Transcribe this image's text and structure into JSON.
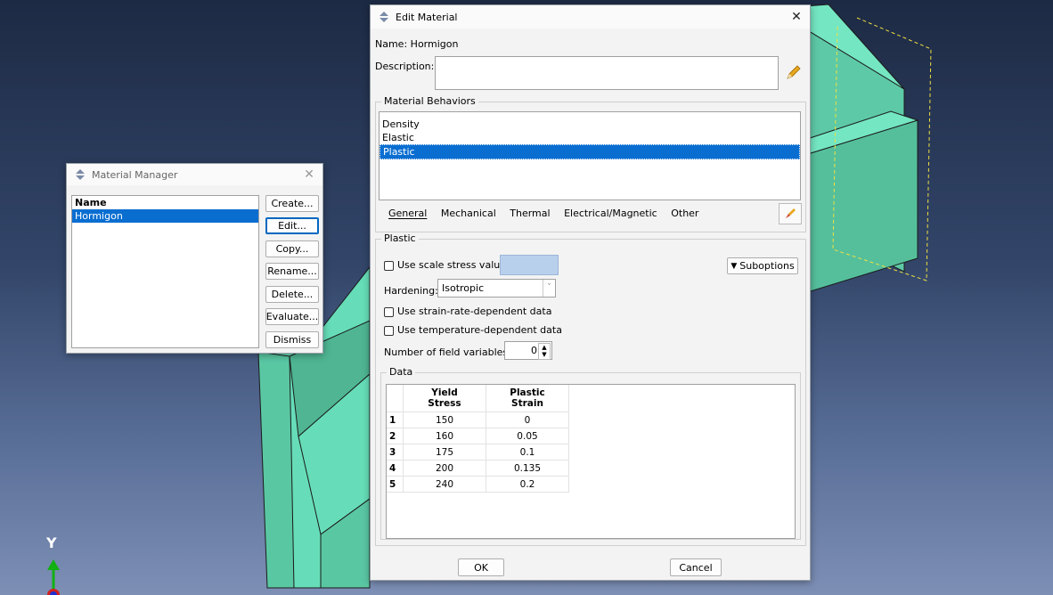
{
  "viewport": {
    "axis_label": "Y",
    "part_color": "#66ddb8",
    "background_top": "#1d2a44",
    "background_bottom": "#7d8fb5"
  },
  "material_manager": {
    "title": "Material Manager",
    "column_header": "Name",
    "items": [
      "Hormigon"
    ],
    "selected_index": 0,
    "buttons": {
      "create": "Create...",
      "edit": "Edit...",
      "copy": "Copy...",
      "rename": "Rename...",
      "delete": "Delete...",
      "evaluate": "Evaluate...",
      "dismiss": "Dismiss"
    }
  },
  "edit_material": {
    "title": "Edit Material",
    "name_label": "Name:",
    "name_value": "Hormigon",
    "description_label": "Description:",
    "description_value": "",
    "behaviors_label": "Material Behaviors",
    "behaviors": [
      "Density",
      "Elastic",
      "Plastic"
    ],
    "selected_behavior": 2,
    "menu": {
      "general": "General",
      "mechanical": "Mechanical",
      "thermal": "Thermal",
      "electrical": "Electrical/Magnetic",
      "other": "Other"
    },
    "plastic": {
      "section_label": "Plastic",
      "use_scale_stress": "Use scale stress value:",
      "suboptions": "Suboptions",
      "hardening_label": "Hardening:",
      "hardening_value": "Isotropic",
      "strain_rate": "Use strain-rate-dependent data",
      "temperature": "Use temperature-dependent data",
      "field_vars_label": "Number of field variables:",
      "field_vars_value": "0",
      "data_label": "Data",
      "columns": [
        [
          "Yield",
          "Stress"
        ],
        [
          "Plastic",
          "Strain"
        ]
      ],
      "rows": [
        [
          "1",
          "150",
          "0"
        ],
        [
          "2",
          "160",
          "0.05"
        ],
        [
          "3",
          "175",
          "0.1"
        ],
        [
          "4",
          "200",
          "0.135"
        ],
        [
          "5",
          "240",
          "0.2"
        ]
      ]
    },
    "ok_label": "OK",
    "cancel_label": "Cancel"
  }
}
